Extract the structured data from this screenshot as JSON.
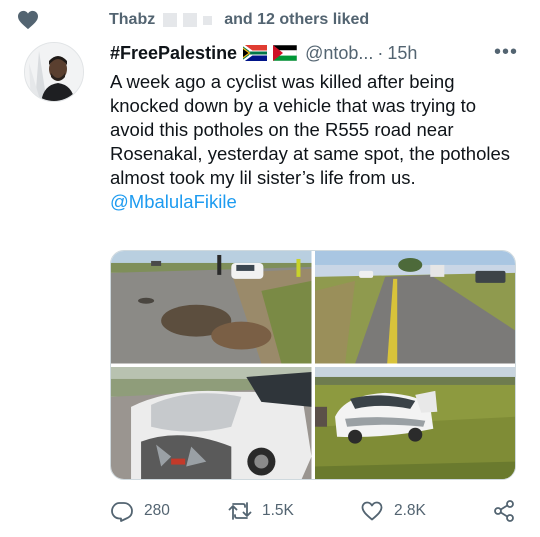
{
  "social_context": {
    "user": "Thabz",
    "suffix": "and 12 others liked",
    "icon": "heart-icon"
  },
  "tweet": {
    "display_name": "#FreePalestine",
    "handle": "@ntob...",
    "separator": "·",
    "time": "15h",
    "more_label": "•••",
    "text_before_mention": "A week ago a cyclist was killed after being knocked down by a vehicle that was trying to avoid this potholes on the R555 road near Rosenakal, yesterday at same spot, the potholes almost took my lil sister’s life from us. ",
    "mention": "@MbalulaFikile",
    "flags": [
      "south-africa-flag",
      "palestine-flag"
    ]
  },
  "actions": {
    "reply_count": "280",
    "retweet_count": "1.5K",
    "like_count": "2.8K"
  },
  "colors": {
    "accent": "#1d9bf0",
    "muted": "#536471",
    "text": "#0f1419",
    "border": "#cfd9de"
  }
}
